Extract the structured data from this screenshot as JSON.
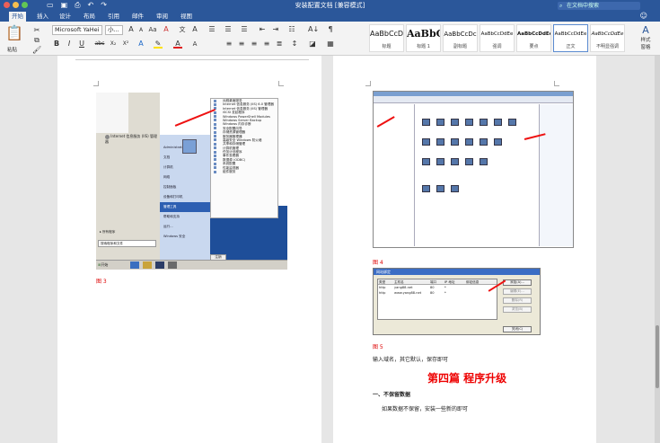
{
  "window": {
    "title": "安装配置文档 [兼容模式]",
    "search_placeholder": "在文档中搜索"
  },
  "tabs": [
    "开始",
    "插入",
    "设计",
    "布局",
    "引用",
    "邮件",
    "审阅",
    "视图"
  ],
  "ribbon": {
    "paste_label": "粘贴",
    "font_name": "Microsoft YaHei",
    "font_size": "小...",
    "font_size_up": "A",
    "font_size_down": "A",
    "change_case": "Aa",
    "clear_format": "A",
    "bold": "B",
    "italic": "I",
    "underline": "U",
    "strike": "abc",
    "subscript": "X₂",
    "superscript": "X²",
    "styles": [
      {
        "preview": "AaBbCcDc",
        "name": "标题"
      },
      {
        "preview": "AaBbC",
        "name": "标题 1"
      },
      {
        "preview": "AaBbCcDc",
        "name": "副标题"
      },
      {
        "preview": "AaBbCcDdEe",
        "name": "强调"
      },
      {
        "preview": "AaBbCcDdEe",
        "name": "要点"
      },
      {
        "preview": "AaBbCcDdEe",
        "name": "正文"
      },
      {
        "preview": "AaBbCcDdEe",
        "name": "不明显强调"
      }
    ],
    "styles_pane": "样式\n窗格"
  },
  "page1": {
    "caption": "图 3",
    "fig3": {
      "header": "Internet 信息服务 (IIS) 管理器",
      "user": "Administrator",
      "mid_items": [
        "文档",
        "计算机",
        "网络",
        "控制面板",
        "设备和打印机",
        "管理工具",
        "帮助和支持",
        "运行...",
        "Windows 安全"
      ],
      "menu_items": [
        "远程桌面服务",
        "Internet 信息服务 (IIS) 6.0 管理器",
        "Internet 信息服务 (IIS) 管理器",
        "iSCSI 发起程序",
        "Windows PowerShell Modules",
        "Windows Server Backup",
        "Windows 内存诊断",
        "安全配置向导",
        "存储资源管理器",
        "服务器管理器",
        "高级安全 Windows 防火墙",
        "共享和存储管理",
        "计算机管理",
        "任务计划程序",
        "事件查看器",
        "数据源 (ODBC)",
        "系统配置",
        "性能监视器",
        "组件服务"
      ],
      "all_programs": "所有程序",
      "search": "搜索程序和文件",
      "shutdown": "注销",
      "start": "开始"
    }
  },
  "page2": {
    "caption4": "图 4",
    "caption5": "图 5",
    "fig5": {
      "title": "网站绑定",
      "columns": [
        "类型",
        "主机名",
        "端口",
        "IP 地址",
        "绑定信息"
      ],
      "rows": [
        [
          "http",
          "yang88.net",
          "80",
          "*",
          ""
        ],
        [
          "http",
          "www.yang88.net",
          "80",
          "*",
          ""
        ]
      ],
      "buttons": [
        "添加(A)...",
        "编辑(E)...",
        "删除(R)",
        "浏览(B)"
      ],
      "close": "关闭(C)"
    },
    "body1": "输入域名，其它默认，保存即可",
    "heading": "第四篇  程序升级",
    "sub1": "一、不保留数据",
    "body2": "如果数据不保留，安装一些新的即可"
  }
}
